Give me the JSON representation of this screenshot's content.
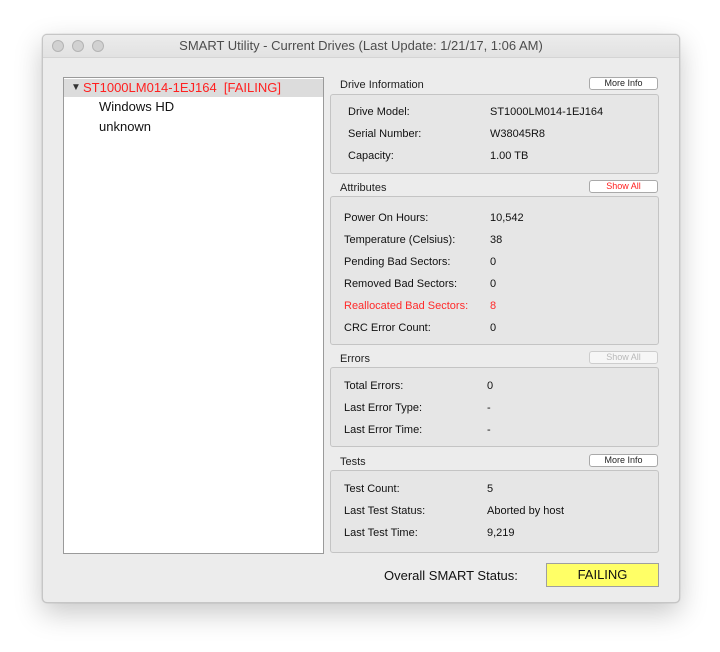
{
  "window": {
    "title": "SMART Utility - Current Drives (Last Update: 1/21/17, 1:06 AM)"
  },
  "drives": {
    "selected_label": "ST1000LM014-1EJ164  [FAILING]",
    "volumes": [
      "Windows HD",
      "unknown"
    ]
  },
  "drive_info": {
    "title": "Drive Information",
    "button": "More Info",
    "rows": [
      {
        "label": "Drive Model:",
        "value": "ST1000LM014-1EJ164"
      },
      {
        "label": "Serial Number:",
        "value": "W38045R8"
      },
      {
        "label": "Capacity:",
        "value": "1.00 TB"
      }
    ]
  },
  "attributes": {
    "title": "Attributes",
    "button": "Show All",
    "rows": [
      {
        "label": "Power On Hours:",
        "value": "10,542"
      },
      {
        "label": "Temperature (Celsius):",
        "value": "38"
      },
      {
        "label": "Pending Bad Sectors:",
        "value": "0"
      },
      {
        "label": "Removed Bad Sectors:",
        "value": "0"
      },
      {
        "label": "Reallocated Bad Sectors:",
        "value": "8"
      },
      {
        "label": "CRC Error Count:",
        "value": "0"
      }
    ]
  },
  "errors": {
    "title": "Errors",
    "button": "Show All",
    "rows": [
      {
        "label": "Total Errors:",
        "value": "0"
      },
      {
        "label": "Last Error Type:",
        "value": "-"
      },
      {
        "label": "Last Error Time:",
        "value": "-"
      }
    ]
  },
  "tests": {
    "title": "Tests",
    "button": "More Info",
    "rows": [
      {
        "label": "Test Count:",
        "value": "5"
      },
      {
        "label": "Last Test Status:",
        "value": "Aborted by host"
      },
      {
        "label": "Last Test Time:",
        "value": "9,219"
      }
    ]
  },
  "overall": {
    "label": "Overall SMART Status:",
    "status": "FAILING"
  },
  "colors": {
    "failing_text": "#ff2020",
    "status_fill": "#ffff66"
  }
}
